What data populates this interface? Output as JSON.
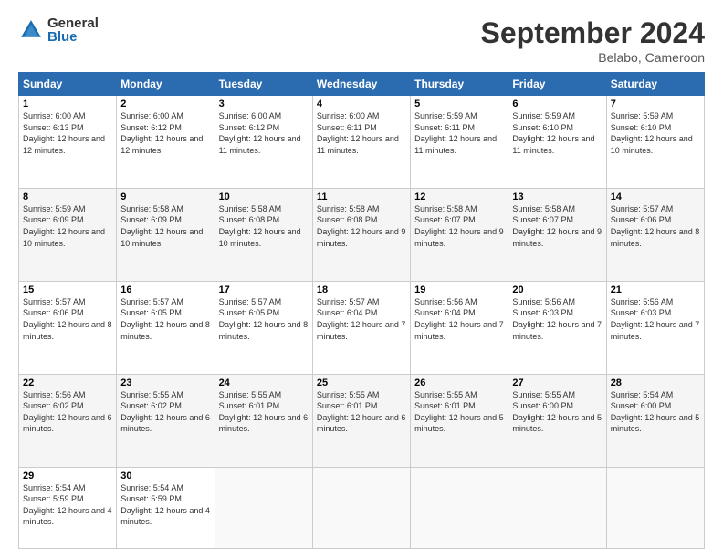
{
  "logo": {
    "general": "General",
    "blue": "Blue"
  },
  "title": "September 2024",
  "location": "Belabo, Cameroon",
  "days_header": [
    "Sunday",
    "Monday",
    "Tuesday",
    "Wednesday",
    "Thursday",
    "Friday",
    "Saturday"
  ],
  "weeks": [
    [
      {
        "num": "1",
        "sunrise": "Sunrise: 6:00 AM",
        "sunset": "Sunset: 6:13 PM",
        "daylight": "Daylight: 12 hours and 12 minutes."
      },
      {
        "num": "2",
        "sunrise": "Sunrise: 6:00 AM",
        "sunset": "Sunset: 6:12 PM",
        "daylight": "Daylight: 12 hours and 12 minutes."
      },
      {
        "num": "3",
        "sunrise": "Sunrise: 6:00 AM",
        "sunset": "Sunset: 6:12 PM",
        "daylight": "Daylight: 12 hours and 11 minutes."
      },
      {
        "num": "4",
        "sunrise": "Sunrise: 6:00 AM",
        "sunset": "Sunset: 6:11 PM",
        "daylight": "Daylight: 12 hours and 11 minutes."
      },
      {
        "num": "5",
        "sunrise": "Sunrise: 5:59 AM",
        "sunset": "Sunset: 6:11 PM",
        "daylight": "Daylight: 12 hours and 11 minutes."
      },
      {
        "num": "6",
        "sunrise": "Sunrise: 5:59 AM",
        "sunset": "Sunset: 6:10 PM",
        "daylight": "Daylight: 12 hours and 11 minutes."
      },
      {
        "num": "7",
        "sunrise": "Sunrise: 5:59 AM",
        "sunset": "Sunset: 6:10 PM",
        "daylight": "Daylight: 12 hours and 10 minutes."
      }
    ],
    [
      {
        "num": "8",
        "sunrise": "Sunrise: 5:59 AM",
        "sunset": "Sunset: 6:09 PM",
        "daylight": "Daylight: 12 hours and 10 minutes."
      },
      {
        "num": "9",
        "sunrise": "Sunrise: 5:58 AM",
        "sunset": "Sunset: 6:09 PM",
        "daylight": "Daylight: 12 hours and 10 minutes."
      },
      {
        "num": "10",
        "sunrise": "Sunrise: 5:58 AM",
        "sunset": "Sunset: 6:08 PM",
        "daylight": "Daylight: 12 hours and 10 minutes."
      },
      {
        "num": "11",
        "sunrise": "Sunrise: 5:58 AM",
        "sunset": "Sunset: 6:08 PM",
        "daylight": "Daylight: 12 hours and 9 minutes."
      },
      {
        "num": "12",
        "sunrise": "Sunrise: 5:58 AM",
        "sunset": "Sunset: 6:07 PM",
        "daylight": "Daylight: 12 hours and 9 minutes."
      },
      {
        "num": "13",
        "sunrise": "Sunrise: 5:58 AM",
        "sunset": "Sunset: 6:07 PM",
        "daylight": "Daylight: 12 hours and 9 minutes."
      },
      {
        "num": "14",
        "sunrise": "Sunrise: 5:57 AM",
        "sunset": "Sunset: 6:06 PM",
        "daylight": "Daylight: 12 hours and 8 minutes."
      }
    ],
    [
      {
        "num": "15",
        "sunrise": "Sunrise: 5:57 AM",
        "sunset": "Sunset: 6:06 PM",
        "daylight": "Daylight: 12 hours and 8 minutes."
      },
      {
        "num": "16",
        "sunrise": "Sunrise: 5:57 AM",
        "sunset": "Sunset: 6:05 PM",
        "daylight": "Daylight: 12 hours and 8 minutes."
      },
      {
        "num": "17",
        "sunrise": "Sunrise: 5:57 AM",
        "sunset": "Sunset: 6:05 PM",
        "daylight": "Daylight: 12 hours and 8 minutes."
      },
      {
        "num": "18",
        "sunrise": "Sunrise: 5:57 AM",
        "sunset": "Sunset: 6:04 PM",
        "daylight": "Daylight: 12 hours and 7 minutes."
      },
      {
        "num": "19",
        "sunrise": "Sunrise: 5:56 AM",
        "sunset": "Sunset: 6:04 PM",
        "daylight": "Daylight: 12 hours and 7 minutes."
      },
      {
        "num": "20",
        "sunrise": "Sunrise: 5:56 AM",
        "sunset": "Sunset: 6:03 PM",
        "daylight": "Daylight: 12 hours and 7 minutes."
      },
      {
        "num": "21",
        "sunrise": "Sunrise: 5:56 AM",
        "sunset": "Sunset: 6:03 PM",
        "daylight": "Daylight: 12 hours and 7 minutes."
      }
    ],
    [
      {
        "num": "22",
        "sunrise": "Sunrise: 5:56 AM",
        "sunset": "Sunset: 6:02 PM",
        "daylight": "Daylight: 12 hours and 6 minutes."
      },
      {
        "num": "23",
        "sunrise": "Sunrise: 5:55 AM",
        "sunset": "Sunset: 6:02 PM",
        "daylight": "Daylight: 12 hours and 6 minutes."
      },
      {
        "num": "24",
        "sunrise": "Sunrise: 5:55 AM",
        "sunset": "Sunset: 6:01 PM",
        "daylight": "Daylight: 12 hours and 6 minutes."
      },
      {
        "num": "25",
        "sunrise": "Sunrise: 5:55 AM",
        "sunset": "Sunset: 6:01 PM",
        "daylight": "Daylight: 12 hours and 6 minutes."
      },
      {
        "num": "26",
        "sunrise": "Sunrise: 5:55 AM",
        "sunset": "Sunset: 6:01 PM",
        "daylight": "Daylight: 12 hours and 5 minutes."
      },
      {
        "num": "27",
        "sunrise": "Sunrise: 5:55 AM",
        "sunset": "Sunset: 6:00 PM",
        "daylight": "Daylight: 12 hours and 5 minutes."
      },
      {
        "num": "28",
        "sunrise": "Sunrise: 5:54 AM",
        "sunset": "Sunset: 6:00 PM",
        "daylight": "Daylight: 12 hours and 5 minutes."
      }
    ],
    [
      {
        "num": "29",
        "sunrise": "Sunrise: 5:54 AM",
        "sunset": "Sunset: 5:59 PM",
        "daylight": "Daylight: 12 hours and 4 minutes."
      },
      {
        "num": "30",
        "sunrise": "Sunrise: 5:54 AM",
        "sunset": "Sunset: 5:59 PM",
        "daylight": "Daylight: 12 hours and 4 minutes."
      },
      null,
      null,
      null,
      null,
      null
    ]
  ]
}
